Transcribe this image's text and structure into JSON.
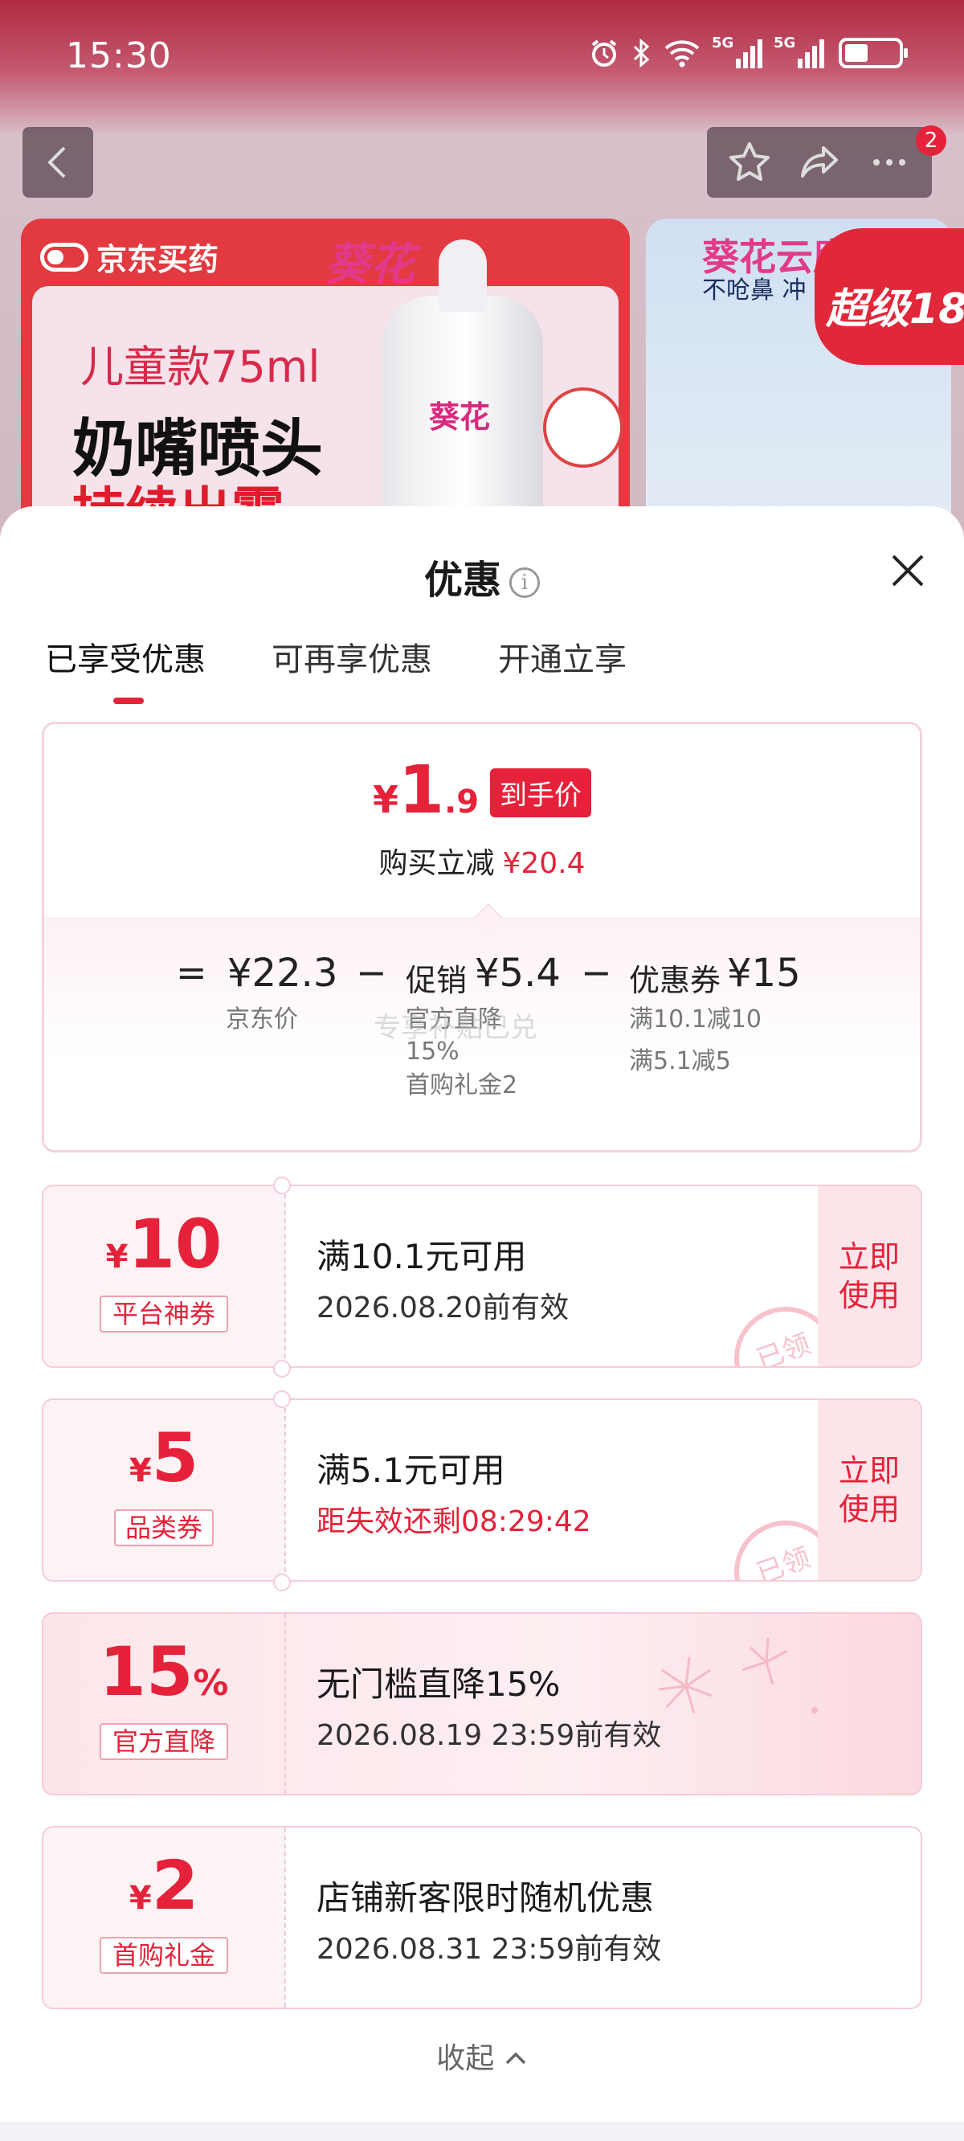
{
  "status_bar": {
    "time": "15:30",
    "network1": "5G",
    "network2": "5G"
  },
  "nav": {
    "notification_count": "2"
  },
  "background": {
    "card_a": {
      "logo": "京东买药",
      "brand": "葵花",
      "line1": "儿童款75ml",
      "line2": "奶嘴喷头",
      "line3": "持续出雾",
      "bottle_label": "葵花"
    },
    "card_b": {
      "brand": "葵花云鹰",
      "sub": "不呛鼻 冲"
    },
    "super_badge": "超级18"
  },
  "sheet": {
    "title": "优惠",
    "tabs": [
      "已享受优惠",
      "可再享优惠",
      "开通立享"
    ]
  },
  "summary": {
    "final_price_int": "1",
    "final_price_dec": ".9",
    "final_price_tag": "到手价",
    "save_label": "购买立减",
    "save_amount": "¥20.4",
    "jd_price": "¥22.3",
    "jd_price_label": "京东价",
    "promo_label": "促销",
    "promo_value": "¥5.4",
    "promo_detail1": "官方直降",
    "promo_detail2": "15%",
    "promo_detail3": "首购礼金2",
    "coupon_label": "优惠券",
    "coupon_value": "¥15",
    "coupon_detail1": "满10.1减10",
    "coupon_detail2": "满5.1减5",
    "watermark": "专享补贴已兑"
  },
  "coupons": [
    {
      "amount": "10",
      "kind": "平台神券",
      "condition": "满10.1元可用",
      "expiry": "2026.08.20前有效",
      "action": "立即使用",
      "stamp": "已领"
    },
    {
      "amount": "5",
      "kind": "品类券",
      "condition": "满5.1元可用",
      "expiry": "距失效还剩08:29:42",
      "action": "立即使用",
      "stamp": "已领"
    },
    {
      "amount": "15",
      "unit": "%",
      "kind": "官方直降",
      "condition": "无门槛直降15%",
      "expiry": "2026.08.19 23:59前有效"
    },
    {
      "amount": "2",
      "kind": "首购礼金",
      "condition": "店铺新客限时随机优惠",
      "expiry": "2026.08.31 23:59前有效"
    }
  ],
  "collapse_label": "收起",
  "colors": {
    "accent": "#e5223a",
    "sheet_bg": "#ffffff"
  }
}
